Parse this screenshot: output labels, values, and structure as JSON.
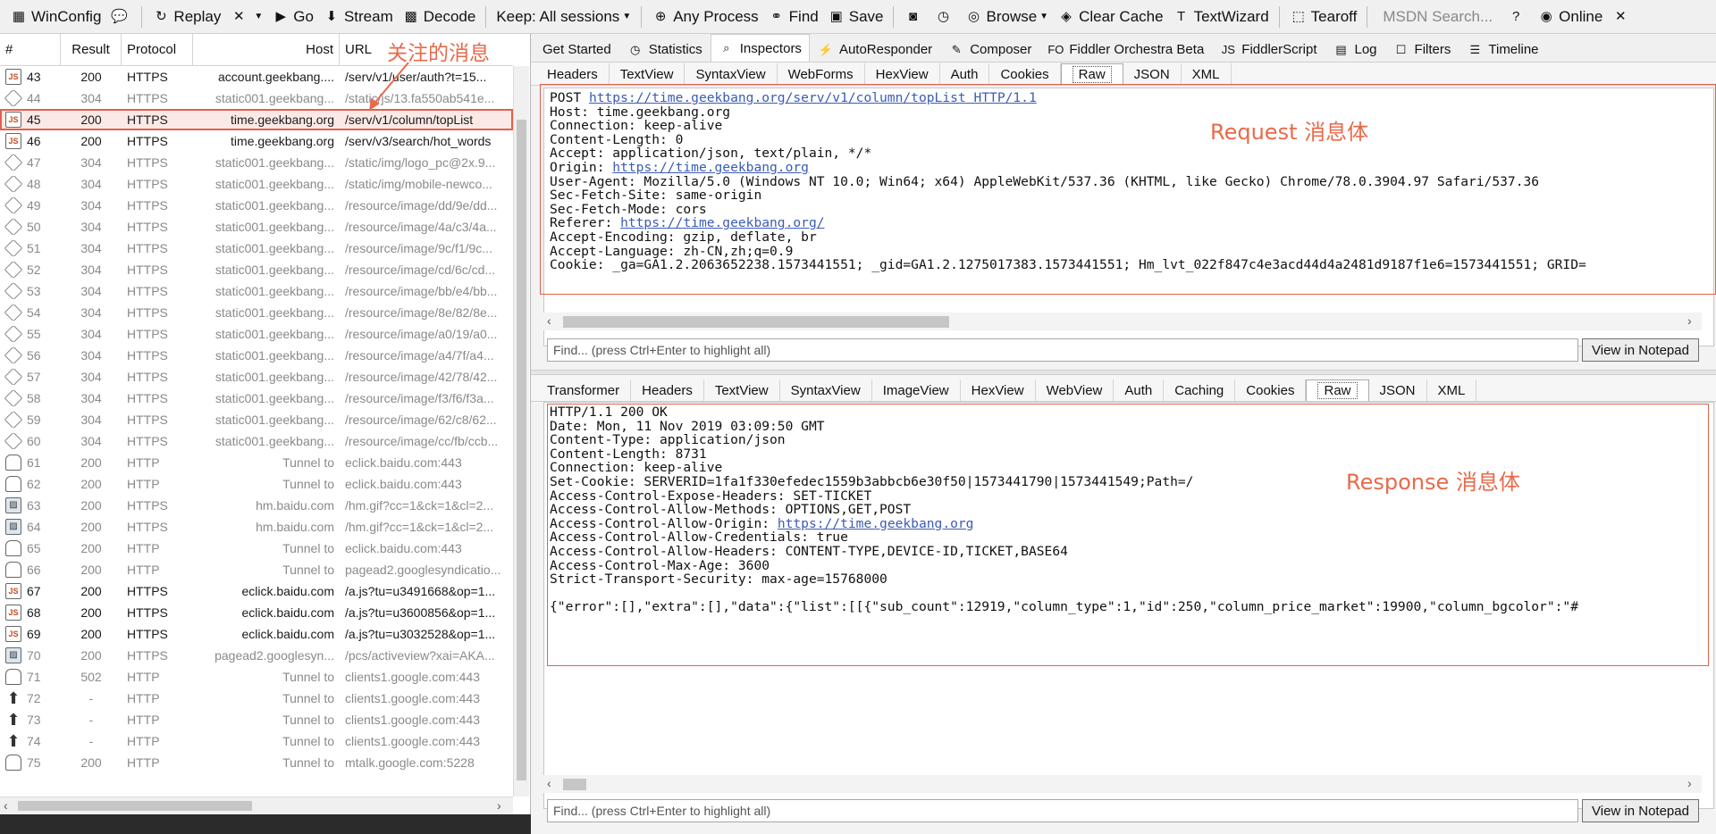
{
  "toolbar": {
    "items": [
      {
        "label": "WinConfig",
        "icon": "windows-icon"
      },
      {
        "label": "",
        "icon": "comment-icon"
      },
      {
        "label": "Replay",
        "icon": "replay-icon"
      },
      {
        "label": "",
        "icon": "remove-icon"
      },
      {
        "label": "Go",
        "icon": "play-icon"
      },
      {
        "label": "Stream",
        "icon": "stream-icon"
      },
      {
        "label": "Decode",
        "icon": "decode-icon"
      },
      {
        "label": "Keep: All sessions",
        "icon": ""
      },
      {
        "label": "Any Process",
        "icon": "crosshair-icon"
      },
      {
        "label": "Find",
        "icon": "binoculars-icon"
      },
      {
        "label": "Save",
        "icon": "save-icon"
      },
      {
        "label": "",
        "icon": "camera-icon"
      },
      {
        "label": "",
        "icon": "timer-icon"
      },
      {
        "label": "Browse",
        "icon": "browser-icon"
      },
      {
        "label": "Clear Cache",
        "icon": "eraser-icon"
      },
      {
        "label": "TextWizard",
        "icon": "textwizard-icon"
      },
      {
        "label": "Tearoff",
        "icon": "tearoff-icon"
      },
      {
        "label": "MSDN Search...",
        "icon": ""
      },
      {
        "label": "",
        "icon": "help-icon"
      },
      {
        "label": "Online",
        "icon": "online-icon"
      },
      {
        "label": "",
        "icon": "close-icon"
      }
    ]
  },
  "sessions": {
    "columns": [
      "#",
      "Result",
      "Protocol",
      "Host",
      "URL"
    ],
    "rows": [
      {
        "num": "43",
        "result": "200",
        "protocol": "HTTPS",
        "host": "account.geekbang....",
        "url": "/serv/v1/user/auth?t=15...",
        "icon": "js",
        "dim": false,
        "selected": false
      },
      {
        "num": "44",
        "result": "304",
        "protocol": "HTTPS",
        "host": "static001.geekbang...",
        "url": "/static/js/13.fa550ab541e...",
        "icon": "diamond",
        "dim": true,
        "selected": false
      },
      {
        "num": "45",
        "result": "200",
        "protocol": "HTTPS",
        "host": "time.geekbang.org",
        "url": "/serv/v1/column/topList",
        "icon": "js",
        "dim": false,
        "selected": true
      },
      {
        "num": "46",
        "result": "200",
        "protocol": "HTTPS",
        "host": "time.geekbang.org",
        "url": "/serv/v3/search/hot_words",
        "icon": "js",
        "dim": false,
        "selected": false
      },
      {
        "num": "47",
        "result": "304",
        "protocol": "HTTPS",
        "host": "static001.geekbang...",
        "url": "/static/img/logo_pc@2x.9...",
        "icon": "diamond",
        "dim": true,
        "selected": false
      },
      {
        "num": "48",
        "result": "304",
        "protocol": "HTTPS",
        "host": "static001.geekbang...",
        "url": "/static/img/mobile-newco...",
        "icon": "diamond",
        "dim": true,
        "selected": false
      },
      {
        "num": "49",
        "result": "304",
        "protocol": "HTTPS",
        "host": "static001.geekbang...",
        "url": "/resource/image/dd/9e/dd...",
        "icon": "diamond",
        "dim": true,
        "selected": false
      },
      {
        "num": "50",
        "result": "304",
        "protocol": "HTTPS",
        "host": "static001.geekbang...",
        "url": "/resource/image/4a/c3/4a...",
        "icon": "diamond",
        "dim": true,
        "selected": false
      },
      {
        "num": "51",
        "result": "304",
        "protocol": "HTTPS",
        "host": "static001.geekbang...",
        "url": "/resource/image/9c/f1/9c...",
        "icon": "diamond",
        "dim": true,
        "selected": false
      },
      {
        "num": "52",
        "result": "304",
        "protocol": "HTTPS",
        "host": "static001.geekbang...",
        "url": "/resource/image/cd/6c/cd...",
        "icon": "diamond",
        "dim": true,
        "selected": false
      },
      {
        "num": "53",
        "result": "304",
        "protocol": "HTTPS",
        "host": "static001.geekbang...",
        "url": "/resource/image/bb/e4/bb...",
        "icon": "diamond",
        "dim": true,
        "selected": false
      },
      {
        "num": "54",
        "result": "304",
        "protocol": "HTTPS",
        "host": "static001.geekbang...",
        "url": "/resource/image/8e/82/8e...",
        "icon": "diamond",
        "dim": true,
        "selected": false
      },
      {
        "num": "55",
        "result": "304",
        "protocol": "HTTPS",
        "host": "static001.geekbang...",
        "url": "/resource/image/a0/19/a0...",
        "icon": "diamond",
        "dim": true,
        "selected": false
      },
      {
        "num": "56",
        "result": "304",
        "protocol": "HTTPS",
        "host": "static001.geekbang...",
        "url": "/resource/image/a4/7f/a4...",
        "icon": "diamond",
        "dim": true,
        "selected": false
      },
      {
        "num": "57",
        "result": "304",
        "protocol": "HTTPS",
        "host": "static001.geekbang...",
        "url": "/resource/image/42/78/42...",
        "icon": "diamond",
        "dim": true,
        "selected": false
      },
      {
        "num": "58",
        "result": "304",
        "protocol": "HTTPS",
        "host": "static001.geekbang...",
        "url": "/resource/image/f3/f6/f3a...",
        "icon": "diamond",
        "dim": true,
        "selected": false
      },
      {
        "num": "59",
        "result": "304",
        "protocol": "HTTPS",
        "host": "static001.geekbang...",
        "url": "/resource/image/62/c8/62...",
        "icon": "diamond",
        "dim": true,
        "selected": false
      },
      {
        "num": "60",
        "result": "304",
        "protocol": "HTTPS",
        "host": "static001.geekbang...",
        "url": "/resource/image/cc/fb/ccb...",
        "icon": "diamond",
        "dim": true,
        "selected": false
      },
      {
        "num": "61",
        "result": "200",
        "protocol": "HTTP",
        "host": "Tunnel to",
        "url": "eclick.baidu.com:443",
        "icon": "lock",
        "dim": true,
        "selected": false
      },
      {
        "num": "62",
        "result": "200",
        "protocol": "HTTP",
        "host": "Tunnel to",
        "url": "eclick.baidu.com:443",
        "icon": "lock",
        "dim": true,
        "selected": false
      },
      {
        "num": "63",
        "result": "200",
        "protocol": "HTTPS",
        "host": "hm.baidu.com",
        "url": "/hm.gif?cc=1&ck=1&cl=2...",
        "icon": "img",
        "dim": true,
        "selected": false
      },
      {
        "num": "64",
        "result": "200",
        "protocol": "HTTPS",
        "host": "hm.baidu.com",
        "url": "/hm.gif?cc=1&ck=1&cl=2...",
        "icon": "img",
        "dim": true,
        "selected": false
      },
      {
        "num": "65",
        "result": "200",
        "protocol": "HTTP",
        "host": "Tunnel to",
        "url": "eclick.baidu.com:443",
        "icon": "lock",
        "dim": true,
        "selected": false
      },
      {
        "num": "66",
        "result": "200",
        "protocol": "HTTP",
        "host": "Tunnel to",
        "url": "pagead2.googlesyndicatio...",
        "icon": "lock",
        "dim": true,
        "selected": false
      },
      {
        "num": "67",
        "result": "200",
        "protocol": "HTTPS",
        "host": "eclick.baidu.com",
        "url": "/a.js?tu=u3491668&op=1...",
        "icon": "js",
        "dim": false,
        "selected": false
      },
      {
        "num": "68",
        "result": "200",
        "protocol": "HTTPS",
        "host": "eclick.baidu.com",
        "url": "/a.js?tu=u3600856&op=1...",
        "icon": "js",
        "dim": false,
        "selected": false
      },
      {
        "num": "69",
        "result": "200",
        "protocol": "HTTPS",
        "host": "eclick.baidu.com",
        "url": "/a.js?tu=u3032528&op=1...",
        "icon": "js",
        "dim": false,
        "selected": false
      },
      {
        "num": "70",
        "result": "200",
        "protocol": "HTTPS",
        "host": "pagead2.googlesyn...",
        "url": "/pcs/activeview?xai=AKA...",
        "icon": "img",
        "dim": true,
        "selected": false
      },
      {
        "num": "71",
        "result": "502",
        "protocol": "HTTP",
        "host": "Tunnel to",
        "url": "clients1.google.com:443",
        "icon": "lock",
        "dim": true,
        "selected": false
      },
      {
        "num": "72",
        "result": "-",
        "protocol": "HTTP",
        "host": "Tunnel to",
        "url": "clients1.google.com:443",
        "icon": "up",
        "dim": true,
        "selected": false
      },
      {
        "num": "73",
        "result": "-",
        "protocol": "HTTP",
        "host": "Tunnel to",
        "url": "clients1.google.com:443",
        "icon": "up",
        "dim": true,
        "selected": false
      },
      {
        "num": "74",
        "result": "-",
        "protocol": "HTTP",
        "host": "Tunnel to",
        "url": "clients1.google.com:443",
        "icon": "up",
        "dim": true,
        "selected": false
      },
      {
        "num": "75",
        "result": "200",
        "protocol": "HTTP",
        "host": "Tunnel to",
        "url": "mtalk.google.com:5228",
        "icon": "lock",
        "dim": true,
        "selected": false
      }
    ]
  },
  "annotations": {
    "focus": "关注的消息",
    "request": "Request 消息体",
    "response": "Response 消息体"
  },
  "main_tabs": [
    {
      "label": "Get Started",
      "icon": ""
    },
    {
      "label": "Statistics",
      "icon": "stopwatch-icon"
    },
    {
      "label": "Inspectors",
      "icon": "inspector-icon",
      "active": true
    },
    {
      "label": "AutoResponder",
      "icon": "lightning-icon"
    },
    {
      "label": "Composer",
      "icon": "pencil-icon"
    },
    {
      "label": "Fiddler Orchestra Beta",
      "icon": "fo-icon"
    },
    {
      "label": "FiddlerScript",
      "icon": "script-icon"
    },
    {
      "label": "Log",
      "icon": "log-icon"
    },
    {
      "label": "Filters",
      "icon": "checkbox-icon"
    },
    {
      "label": "Timeline",
      "icon": "timeline-icon"
    }
  ],
  "request_tabs": [
    {
      "label": "Headers"
    },
    {
      "label": "TextView"
    },
    {
      "label": "SyntaxView"
    },
    {
      "label": "WebForms"
    },
    {
      "label": "HexView"
    },
    {
      "label": "Auth"
    },
    {
      "label": "Cookies"
    },
    {
      "label": "Raw",
      "active": true
    },
    {
      "label": "JSON"
    },
    {
      "label": "XML"
    }
  ],
  "response_tabs": [
    {
      "label": "Transformer"
    },
    {
      "label": "Headers"
    },
    {
      "label": "TextView"
    },
    {
      "label": "SyntaxView"
    },
    {
      "label": "ImageView"
    },
    {
      "label": "HexView"
    },
    {
      "label": "WebView"
    },
    {
      "label": "Auth"
    },
    {
      "label": "Caching"
    },
    {
      "label": "Cookies"
    },
    {
      "label": "Raw",
      "active": true
    },
    {
      "label": "JSON"
    },
    {
      "label": "XML"
    }
  ],
  "request_raw": {
    "method": "POST ",
    "url": "https://time.geekbang.org/serv/v1/column/topList HTTP/1.1",
    "lines": [
      "Host: time.geekbang.org",
      "Connection: keep-alive",
      "Content-Length: 0",
      "Accept: application/json, text/plain, */*"
    ],
    "origin_key": "Origin: ",
    "origin_val": "https://time.geekbang.org",
    "lines2": [
      "User-Agent: Mozilla/5.0 (Windows NT 10.0; Win64; x64) AppleWebKit/537.36 (KHTML, like Gecko) Chrome/78.0.3904.97 Safari/537.36",
      "Sec-Fetch-Site: same-origin",
      "Sec-Fetch-Mode: cors"
    ],
    "referer_key": "Referer: ",
    "referer_val": "https://time.geekbang.org/",
    "lines3": [
      "Accept-Encoding: gzip, deflate, br",
      "Accept-Language: zh-CN,zh;q=0.9",
      "Cookie: _ga=GA1.2.2063652238.1573441551; _gid=GA1.2.1275017383.1573441551; Hm_lvt_022f847c4e3acd44d4a2481d9187f1e6=1573441551; GRID="
    ]
  },
  "response_raw": {
    "lines": [
      "HTTP/1.1 200 OK",
      "Date: Mon, 11 Nov 2019 03:09:50 GMT",
      "Content-Type: application/json",
      "Content-Length: 8731",
      "Connection: keep-alive",
      "Set-Cookie: SERVERID=1fa1f330efedec1559b3abbcb6e30f50|1573441790|1573441549;Path=/",
      "Access-Control-Expose-Headers: SET-TICKET",
      "Access-Control-Allow-Methods: OPTIONS,GET,POST"
    ],
    "acao_key": "Access-Control-Allow-Origin: ",
    "acao_val": "https://time.geekbang.org",
    "lines2": [
      "Access-Control-Allow-Credentials: true",
      "Access-Control-Allow-Headers: CONTENT-TYPE,DEVICE-ID,TICKET,BASE64",
      "Access-Control-Max-Age: 3600",
      "Strict-Transport-Security: max-age=15768000",
      "",
      "{\"error\":[],\"extra\":[],\"data\":{\"list\":[[{\"sub_count\":12919,\"column_type\":1,\"id\":250,\"column_price_market\":19900,\"column_bgcolor\":\"#"
    ]
  },
  "find": {
    "placeholder": "Find... (press Ctrl+Enter to highlight all)",
    "notepad_label": "View in Notepad"
  }
}
